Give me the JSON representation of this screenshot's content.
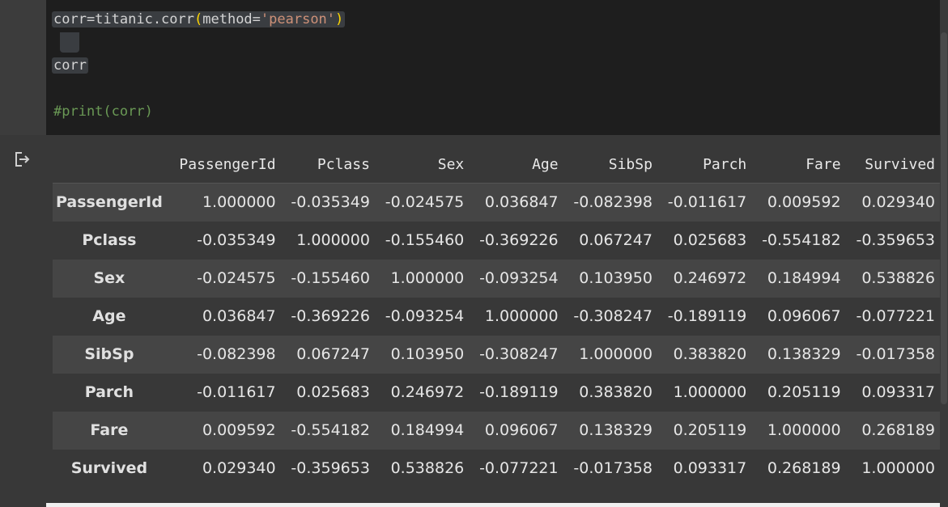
{
  "code": {
    "line1": {
      "pre": "corr=titanic.corr",
      "open": "(",
      "arg": "method=",
      "str": "'pearson'",
      "close": ")"
    },
    "line2": "corr",
    "line3": "#print(corr)"
  },
  "output": {
    "icon": "output-redirect-icon",
    "columns": [
      "PassengerId",
      "Pclass",
      "Sex",
      "Age",
      "SibSp",
      "Parch",
      "Fare",
      "Survived"
    ],
    "rows": [
      {
        "label": "PassengerId",
        "values": [
          "1.000000",
          "-0.035349",
          "-0.024575",
          "0.036847",
          "-0.082398",
          "-0.011617",
          "0.009592",
          "0.029340"
        ]
      },
      {
        "label": "Pclass",
        "values": [
          "-0.035349",
          "1.000000",
          "-0.155460",
          "-0.369226",
          "0.067247",
          "0.025683",
          "-0.554182",
          "-0.359653"
        ]
      },
      {
        "label": "Sex",
        "values": [
          "-0.024575",
          "-0.155460",
          "1.000000",
          "-0.093254",
          "0.103950",
          "0.246972",
          "0.184994",
          "0.538826"
        ]
      },
      {
        "label": "Age",
        "values": [
          "0.036847",
          "-0.369226",
          "-0.093254",
          "1.000000",
          "-0.308247",
          "-0.189119",
          "0.096067",
          "-0.077221"
        ]
      },
      {
        "label": "SibSp",
        "values": [
          "-0.082398",
          "0.067247",
          "0.103950",
          "-0.308247",
          "1.000000",
          "0.383820",
          "0.138329",
          "-0.017358"
        ]
      },
      {
        "label": "Parch",
        "values": [
          "-0.011617",
          "0.025683",
          "0.246972",
          "-0.189119",
          "0.383820",
          "1.000000",
          "0.205119",
          "0.093317"
        ]
      },
      {
        "label": "Fare",
        "values": [
          "0.009592",
          "-0.554182",
          "0.184994",
          "0.096067",
          "0.138329",
          "0.205119",
          "1.000000",
          "0.268189"
        ]
      },
      {
        "label": "Survived",
        "values": [
          "0.029340",
          "-0.359653",
          "0.538826",
          "-0.077221",
          "-0.017358",
          "0.093317",
          "0.268189",
          "1.000000"
        ]
      }
    ]
  }
}
